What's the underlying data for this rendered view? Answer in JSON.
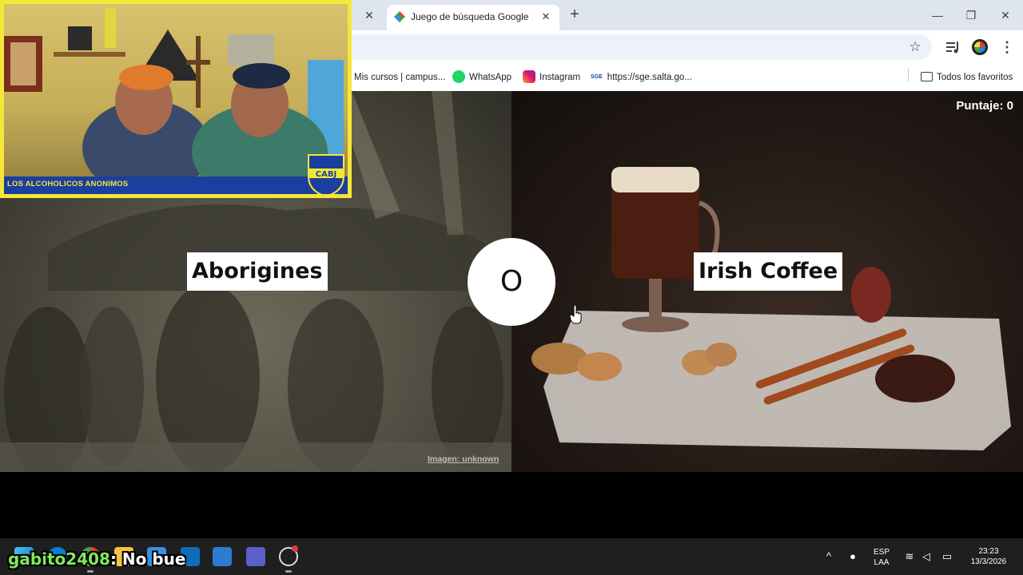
{
  "browser": {
    "active_tab": {
      "title": "Juego de búsqueda Google : ¿Cuál tiene más búsquedas?"
    },
    "bookmarks": [
      {
        "label": "Mis cursos | campus...",
        "icon": "campus-icon"
      },
      {
        "label": "WhatsApp",
        "icon": "whatsapp-icon"
      },
      {
        "label": "Instagram",
        "icon": "instagram-icon"
      },
      {
        "label": "https://sge.salta.go...",
        "icon": "sge-icon",
        "icon_text": "SGE"
      }
    ],
    "all_bookmarks_label": "Todos los favoritos"
  },
  "game": {
    "left_option": "Aborigines",
    "right_option": "Irish Coffee",
    "or_label": "O",
    "score_label": "Puntaje: 0",
    "image_credit": "Imagen: unknown"
  },
  "webcam": {
    "banner_text": "LOS ALCOHOLICOS ANONIMOS",
    "badge_text": "CABJ"
  },
  "chat": {
    "username": "gabito2408",
    "message": ": No bue"
  },
  "taskbar": {
    "language": "ESP",
    "layout": "LAA",
    "time": "23:23",
    "date": "13/3/2026"
  },
  "colors": {
    "webcam_border": "#f5e63a",
    "banner_bg": "#1a3f9e",
    "chat_username": "#7fe85b"
  }
}
